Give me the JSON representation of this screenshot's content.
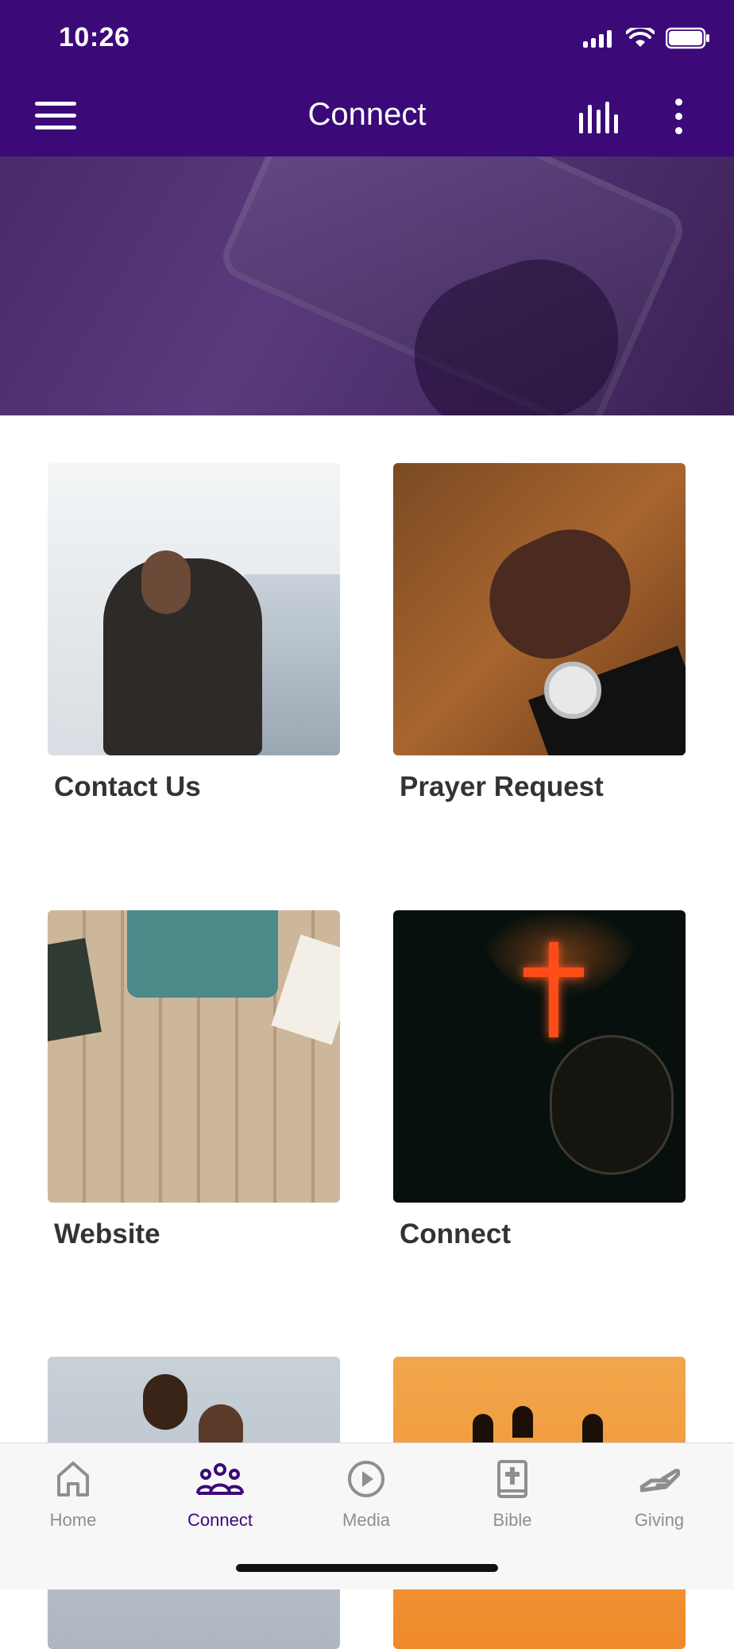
{
  "status_bar": {
    "time": "10:26"
  },
  "header": {
    "title": "Connect"
  },
  "tiles": [
    {
      "label": "Contact Us"
    },
    {
      "label": "Prayer Request"
    },
    {
      "label": "Website"
    },
    {
      "label": "Connect"
    }
  ],
  "tabbar": {
    "items": [
      {
        "label": "Home",
        "icon": "home-icon"
      },
      {
        "label": "Connect",
        "icon": "people-icon"
      },
      {
        "label": "Media",
        "icon": "play-circle-icon"
      },
      {
        "label": "Bible",
        "icon": "bible-icon"
      },
      {
        "label": "Giving",
        "icon": "giving-hand-icon"
      }
    ],
    "active": "Connect"
  },
  "colors": {
    "brand": "#3b0a78",
    "inactive_tab": "#8f8f8f",
    "label_text": "#333333"
  }
}
